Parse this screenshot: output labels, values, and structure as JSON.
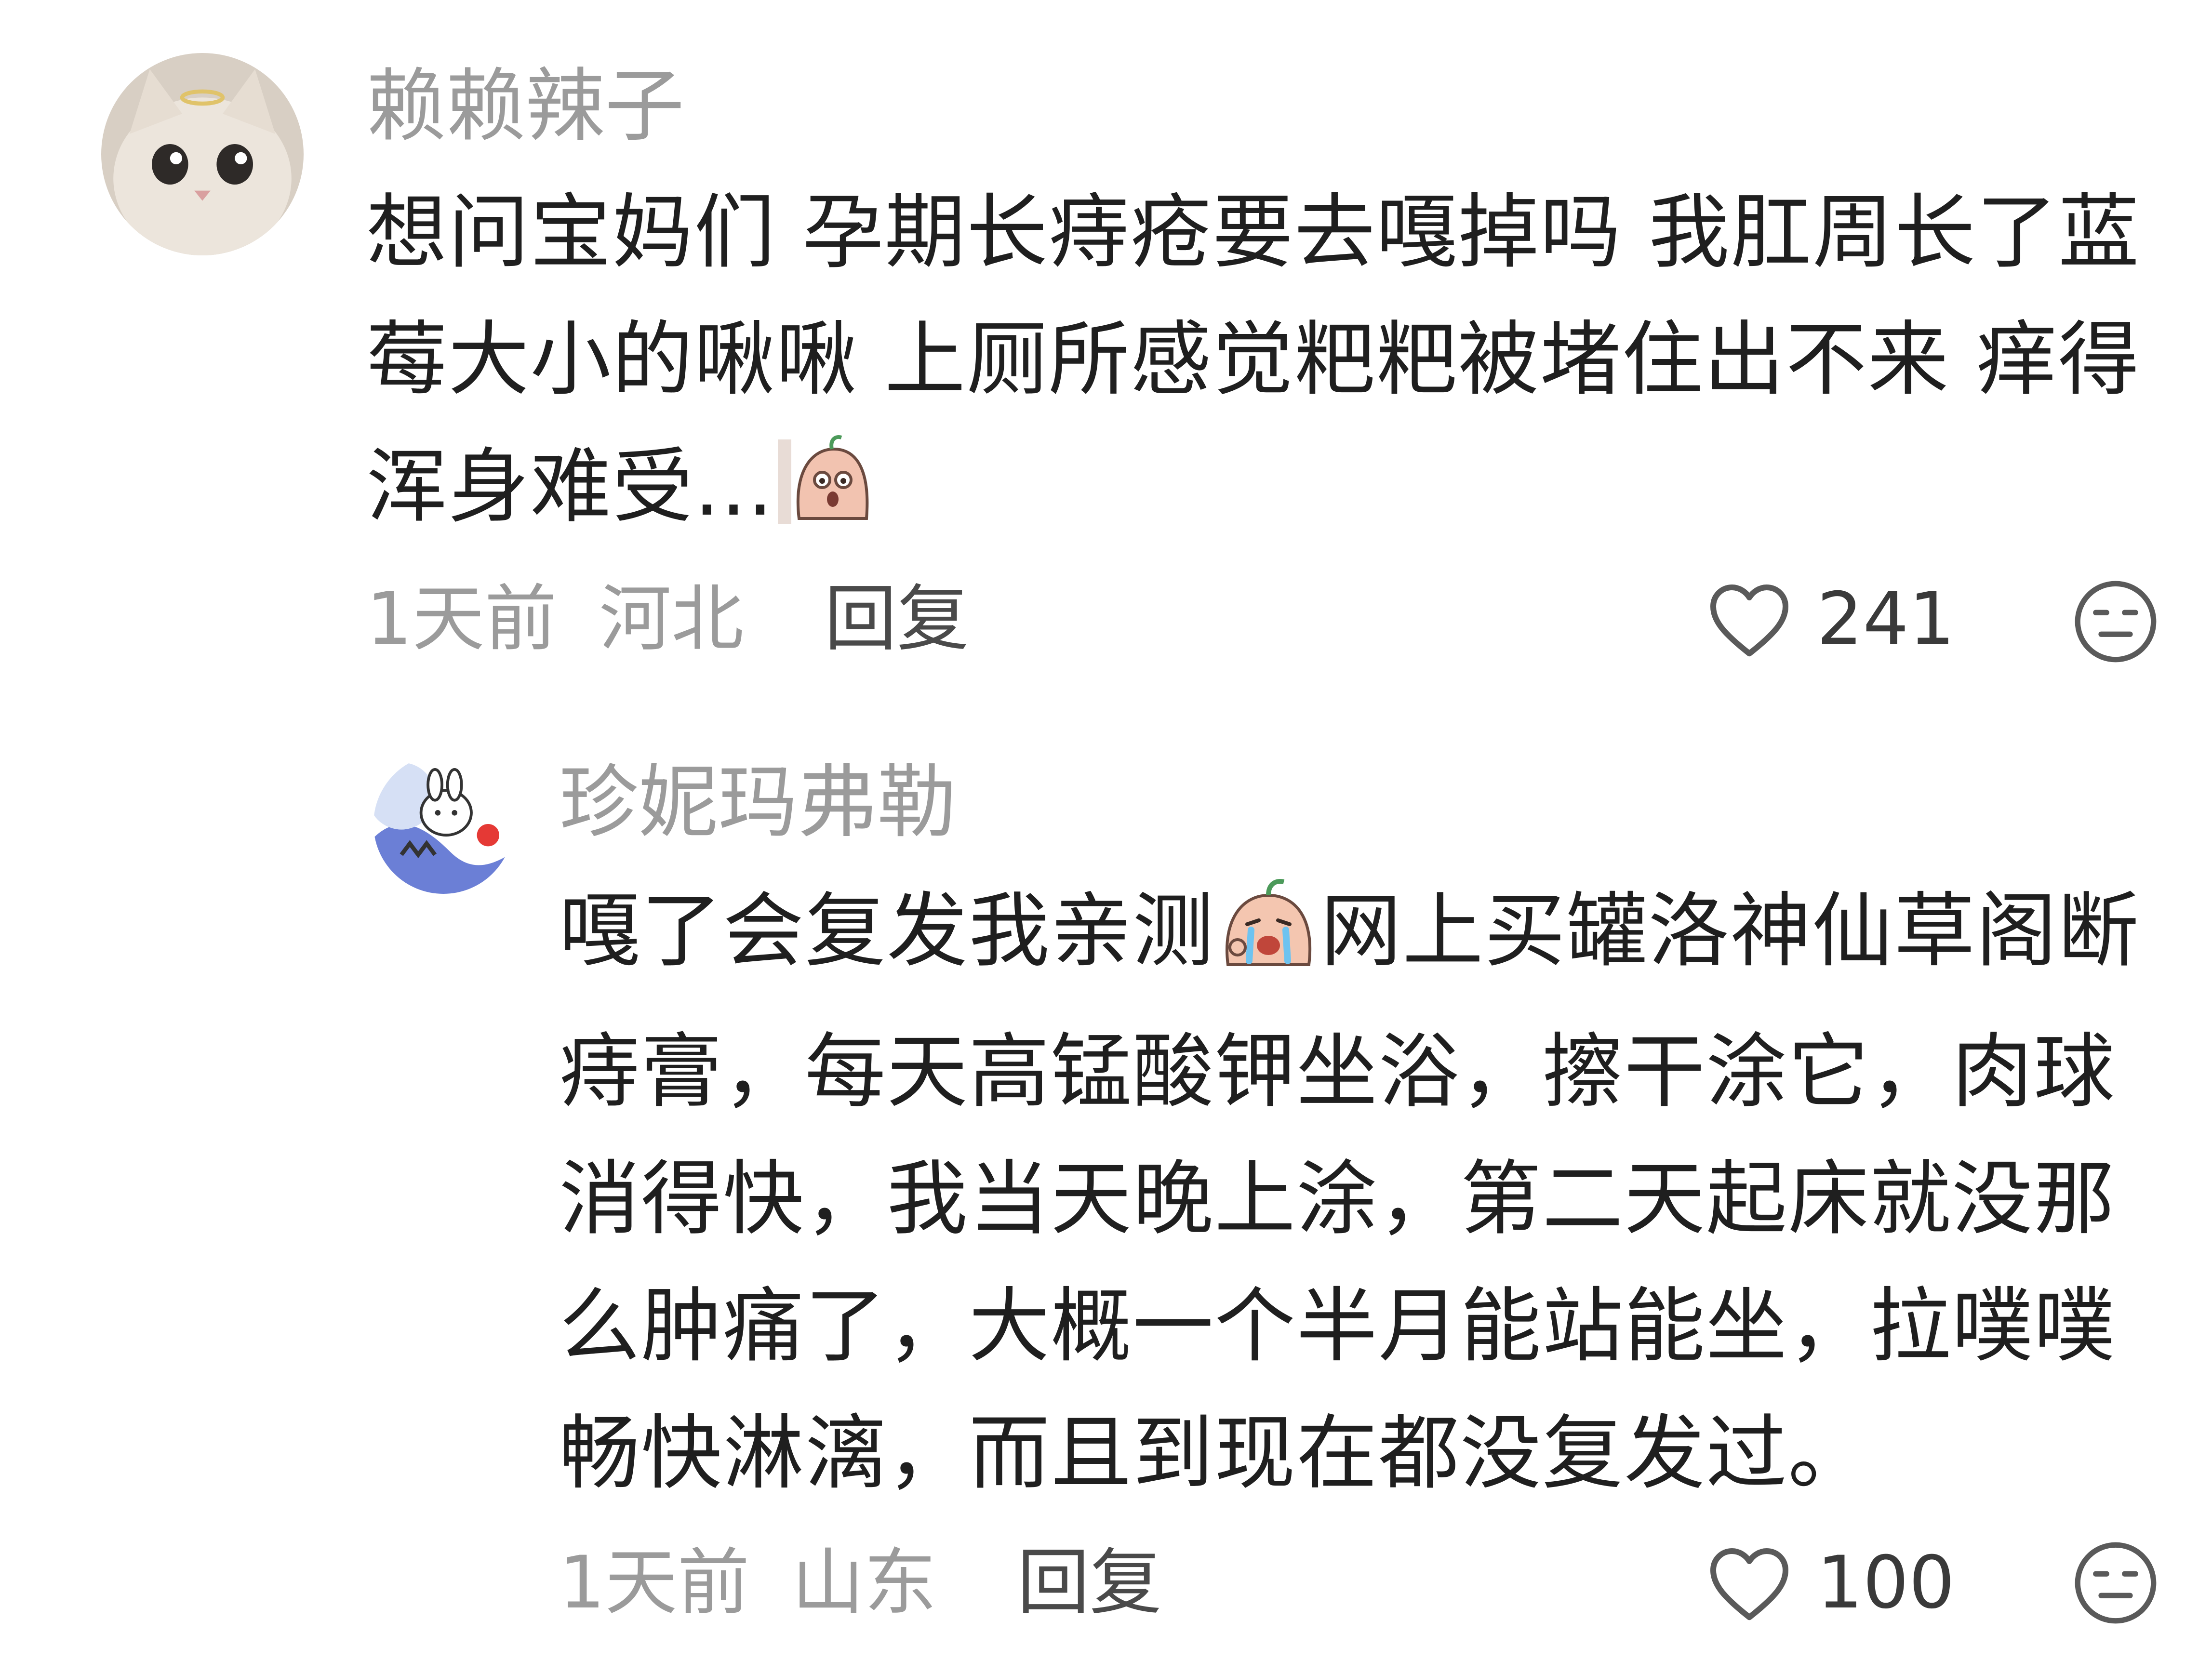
{
  "comments": [
    {
      "username": "赖赖辣子",
      "avatar_icon": "cat-avatar",
      "text_lines": [
        "想问宝妈们 孕期长痔疮要去嘎掉吗 我肛周长了蓝",
        "莓大小的啾啾 上厕所感觉粑粑被堵住出不来 痒得",
        "浑身难受..."
      ],
      "sticker_icon": "peeking-peach-sticker",
      "time": "1天前",
      "location": "河北",
      "reply_label": "回复",
      "likes": "241"
    },
    {
      "username": "珍妮玛弗勒",
      "avatar_icon": "rabbit-shark-avatar",
      "text_lines": [
        "嘎了会复发我亲测",
        "网上买罐洛神仙草阁断",
        "痔膏，每天高锰酸钾坐浴，擦干涂它，肉球",
        "消得快，我当天晚上涂，第二天起床就没那",
        "么肿痛了，大概一个半月能站能坐，拉噗噗",
        "畅快淋漓，而且到现在都没复发过。"
      ],
      "sticker_icon": "crying-peach-sticker",
      "time": "1天前",
      "location": "山东",
      "reply_label": "回复",
      "likes": "100"
    }
  ],
  "icons": {
    "like": "heart-outline-icon",
    "reaction": "neutral-face-icon"
  },
  "colors": {
    "text": "#1f1f1f",
    "muted": "#9b9b9b",
    "reply": "#4a4a4a"
  }
}
